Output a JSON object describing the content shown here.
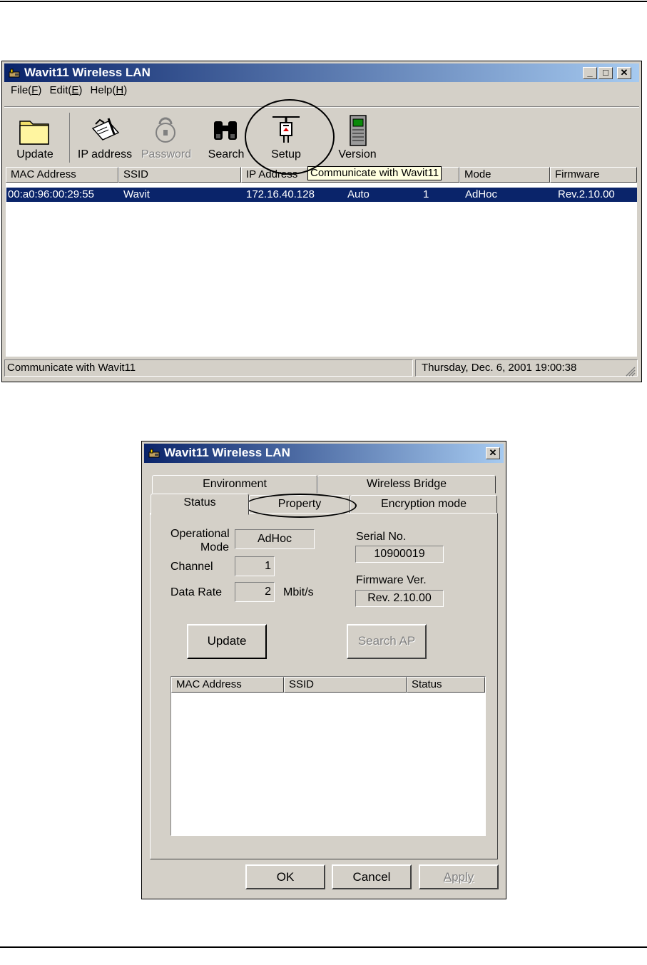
{
  "main_window": {
    "title": "Wavit11 Wireless LAN",
    "menu": [
      {
        "label": "File(",
        "key": "F",
        "end": ")"
      },
      {
        "label": "Edit(",
        "key": "E",
        "end": ")"
      },
      {
        "label": "Help(",
        "key": "H",
        "end": ")"
      }
    ],
    "toolbar": {
      "update": "Update",
      "ip_address": "IP address",
      "password": "Password",
      "search": "Search",
      "setup": "Setup",
      "version": "Version"
    },
    "tooltip": "Communicate with Wavit11",
    "columns": [
      "MAC Address",
      "SSID",
      "IP Address",
      "Mode",
      "Firmware"
    ],
    "row": {
      "mac": "00:a0:96:00:29:55",
      "ssid": "Wavit",
      "ip": "172.16.40.128",
      "extra1": "Auto",
      "extra2": "1",
      "mode": "AdHoc",
      "firmware": "Rev.2.10.00"
    },
    "status_left": "Communicate with Wavit11",
    "status_right": "Thursday,  Dec.  6, 2001  19:00:38"
  },
  "dialog": {
    "title": "Wavit11 Wireless LAN",
    "tabs_back": [
      "Environment",
      "Wireless Bridge"
    ],
    "tabs_front": [
      "Status",
      "Property",
      "Encryption mode"
    ],
    "operational_label_1": "Operational",
    "operational_label_2": "Mode",
    "operational_value": "AdHoc",
    "channel_label": "Channel",
    "channel_value": "1",
    "datarate_label": "Data Rate",
    "datarate_value": "2",
    "datarate_unit": "Mbit/s",
    "serial_label": "Serial No.",
    "serial_value": "10900019",
    "fw_label": "Firmware Ver.",
    "fw_value": "Rev. 2.10.00",
    "update_btn": "Update",
    "search_btn": "Search AP",
    "ap_columns": [
      "MAC Address",
      "SSID",
      "Status"
    ],
    "ok": "OK",
    "cancel": "Cancel",
    "apply": "Apply"
  },
  "icons": [
    "app-icon",
    "minimize-icon",
    "maximize-icon",
    "close-icon",
    "folder-icon",
    "notepad-icon",
    "padlock-icon",
    "binoculars-icon",
    "plug-icon",
    "circuit-icon"
  ]
}
